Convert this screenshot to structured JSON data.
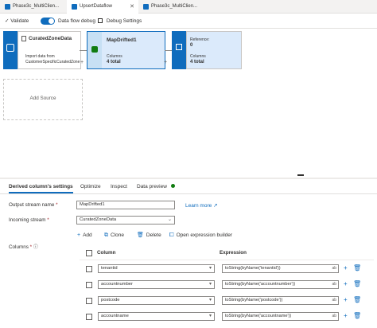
{
  "tabs": [
    {
      "label": "Phase3c_MultiClien...",
      "color": "#0f6cbd"
    },
    {
      "label": "UpsertDataflow",
      "color": "#0f6cbd",
      "active": true
    },
    {
      "label": "Phase3c_MultiClien...",
      "color": "#0f6cbd"
    }
  ],
  "toolbar": {
    "validate_label": "Validate",
    "debug_label": "Data flow debug",
    "debug_settings_label": "Debug Settings",
    "debug_on": true
  },
  "canvas": {
    "source_node": {
      "title": "CuratedZoneData",
      "desc_line1": "Import data from",
      "desc_line2": "CustomerSpecificCuratedZone"
    },
    "derived_node": {
      "title": "MapDrifted1",
      "columns_label": "Columns",
      "columns_value": "4 total"
    },
    "sink_node": {
      "ref_label": "Reference:",
      "ref_value": "0",
      "columns_label": "Columns",
      "columns_value": "4 total"
    },
    "add_source_label": "Add Source"
  },
  "panel": {
    "tabs": [
      "Derived column's settings",
      "Optimize",
      "Inspect",
      "Data preview"
    ],
    "output_stream_label": "Output stream name",
    "output_stream_value": "MapDrifted1",
    "learn_more_label": "Learn more",
    "incoming_stream_label": "Incoming stream",
    "incoming_stream_value": "CuratedZoneData",
    "columns_label": "Columns",
    "actions": {
      "add": "Add",
      "clone": "Clone",
      "delete": "Delete",
      "open_builder": "Open expression builder"
    },
    "table": {
      "column_header": "Column",
      "expression_header": "Expression",
      "rows": [
        {
          "column": "tenantid",
          "expression": "toString(byName('tenantid'))"
        },
        {
          "column": "accountnumber",
          "expression": "toString(byName('accountnumber'))"
        },
        {
          "column": "postcode",
          "expression": "toString(byName('postcode'))"
        },
        {
          "column": "accountname",
          "expression": "toString(byName('accountname'))"
        }
      ]
    }
  },
  "colors": {
    "accent": "#0f6cbd",
    "status_green": "#107c10"
  }
}
